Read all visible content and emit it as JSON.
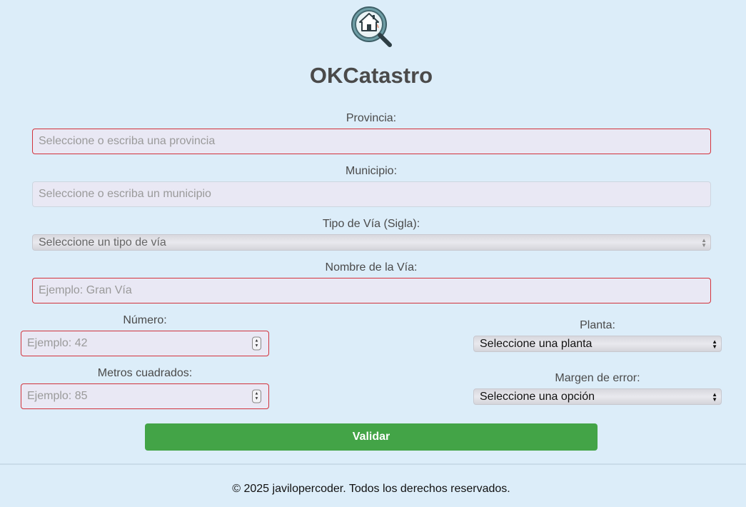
{
  "app": {
    "title": "OKCatastro",
    "logo_icon": "house-magnifier-icon"
  },
  "form": {
    "provincia": {
      "label": "Provincia:",
      "placeholder": "Seleccione o escriba una provincia"
    },
    "municipio": {
      "label": "Municipio:",
      "placeholder": "Seleccione o escriba un municipio"
    },
    "tipo_via": {
      "label": "Tipo de Vía (Sigla):",
      "selected": "Seleccione un tipo de vía"
    },
    "nombre_via": {
      "label": "Nombre de la Vía:",
      "placeholder": "Ejemplo: Gran Vía"
    },
    "numero": {
      "label": "Número:",
      "placeholder": "Ejemplo: 42"
    },
    "metros": {
      "label": "Metros cuadrados:",
      "placeholder": "Ejemplo: 85"
    },
    "planta": {
      "label": "Planta:",
      "selected": "Seleccione una planta"
    },
    "margen": {
      "label": "Margen de error:",
      "selected": "Seleccione una opción"
    },
    "submit_label": "Validar"
  },
  "footer": {
    "text": "© 2025 javilopercoder. Todos los derechos reservados."
  },
  "colors": {
    "background": "#dcedf9",
    "field_bg": "#e9e8f4",
    "required_border": "#d2333c",
    "button": "#43a447"
  }
}
